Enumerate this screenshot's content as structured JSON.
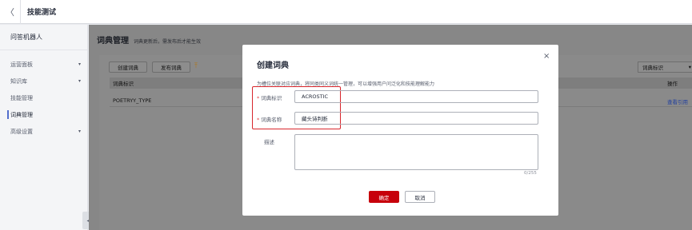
{
  "topbar": {
    "back_icon": "chevron-left-icon",
    "back_glyph": "〈",
    "title": "技能测试"
  },
  "sidebar": {
    "header": "问答机器人",
    "items": [
      {
        "label": "运营面板",
        "chevron": "▾"
      },
      {
        "label": "知识库",
        "chevron": "▾"
      },
      {
        "label": "技能管理",
        "chevron": ""
      },
      {
        "label": "词典管理",
        "chevron": "",
        "active": true
      },
      {
        "label": "高级设置",
        "chevron": "▾"
      }
    ],
    "collapse_glyph": "◂"
  },
  "page": {
    "title": "词典管理",
    "subtitle": "词典更新后，需发布后才能生效"
  },
  "toolbar": {
    "create_label": "创建词典",
    "publish_label": "发布词典",
    "upload_icon": "upload-icon",
    "upload_glyph": "⤒",
    "select_value": "词典标识",
    "select_glyph": "▾"
  },
  "table": {
    "headers": {
      "id": "词典标识",
      "ops": "操作"
    },
    "rows": [
      {
        "id": "POETRYY_TYPE",
        "ops": "查看引用"
      }
    ]
  },
  "modal": {
    "title": "创建词典",
    "close_glyph": "×",
    "description": "为槽位关联对应词典，将同类同义词统一管理，可以增强用户问泛化和技能理解能力",
    "fields": {
      "id_label": "词典标识",
      "id_value": "ACROSTIC",
      "name_label": "词典名称",
      "name_value": "藏头诗判断",
      "desc_label": "描述",
      "desc_value": "",
      "counter": "0/255",
      "required_mark": "*"
    },
    "ok_label": "确定",
    "cancel_label": "取消"
  },
  "colors": {
    "primary": "#c7000b",
    "highlight": "#d8262c",
    "accent": "#526ecc"
  }
}
